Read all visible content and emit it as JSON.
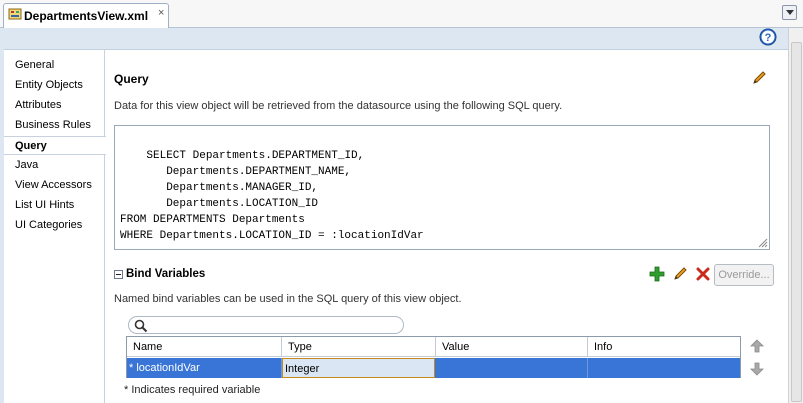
{
  "tab": {
    "title": "DepartmentsView.xml",
    "close": "×"
  },
  "nav": {
    "items": [
      {
        "label": "General"
      },
      {
        "label": "Entity Objects"
      },
      {
        "label": "Attributes"
      },
      {
        "label": "Business Rules"
      },
      {
        "label": "Query",
        "selected": true
      },
      {
        "label": "Java"
      },
      {
        "label": "View Accessors"
      },
      {
        "label": "List UI Hints"
      },
      {
        "label": "UI Categories"
      }
    ]
  },
  "query": {
    "title": "Query",
    "description": "Data for this view object will be retrieved from the datasource using the following SQL query.",
    "sql": "SELECT Departments.DEPARTMENT_ID,\n       Departments.DEPARTMENT_NAME,\n       Departments.MANAGER_ID,\n       Departments.LOCATION_ID\nFROM DEPARTMENTS Departments\nWHERE Departments.LOCATION_ID = :locationIdVar"
  },
  "bind": {
    "title": "Bind Variables",
    "description": "Named bind variables can be used in the SQL query of this view object.",
    "override_label": "Override...",
    "search_value": "",
    "columns": [
      "Name",
      "Type",
      "Value",
      "Info"
    ],
    "rows": [
      {
        "name": "* locationIdVar",
        "type": "Integer",
        "value": "",
        "info": ""
      }
    ],
    "footnote": "* Indicates required variable"
  },
  "colors": {
    "selection": "#3875d7",
    "header_band": "#dde7f2",
    "add_green": "#2e9e2e",
    "delete_red": "#cc2a1a",
    "edit_pencil": "#e08a00"
  },
  "icons": [
    "xml-file-icon",
    "help-icon",
    "edit-pencil-icon",
    "collapse-icon",
    "add-icon",
    "delete-icon",
    "search-icon",
    "move-up-icon",
    "move-down-icon",
    "tab-menu-icon"
  ]
}
